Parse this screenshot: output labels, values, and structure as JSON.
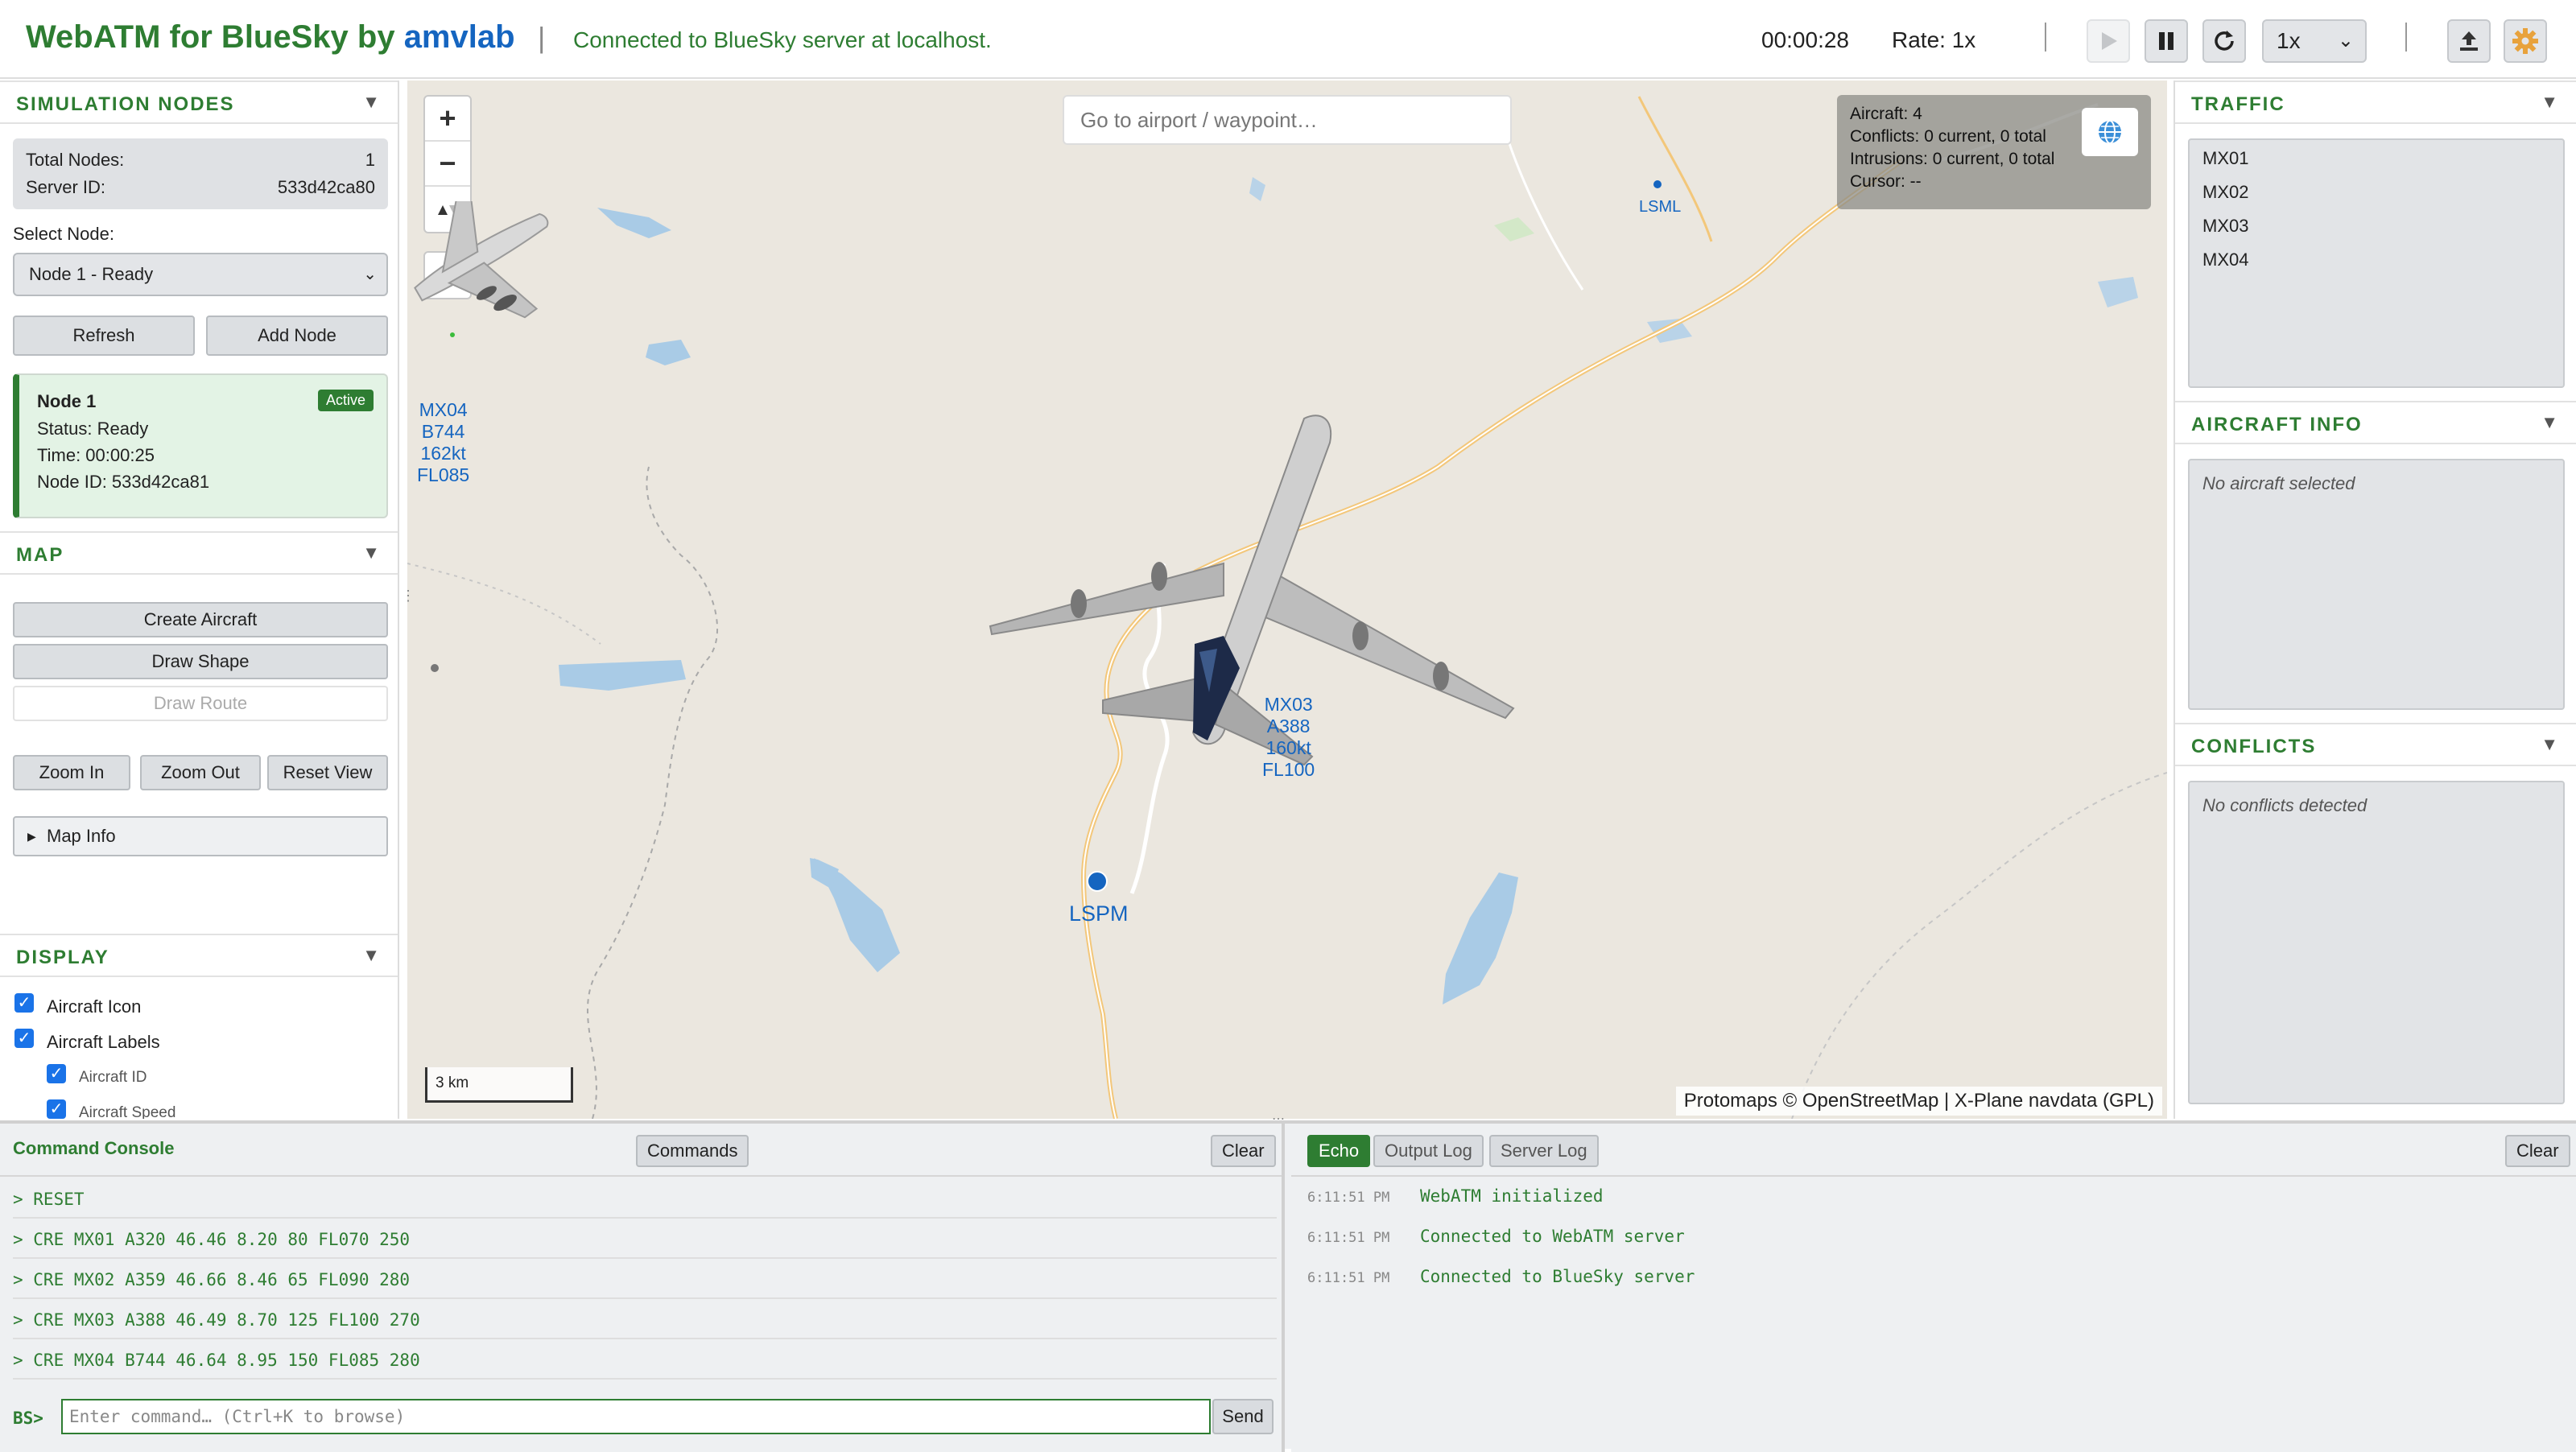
{
  "header": {
    "title_prefix": "WebATM for BlueSky by ",
    "title_brand": "amvlab",
    "separator": "|",
    "connection_status": "Connected to BlueSky server at localhost.",
    "sim_time": "00:00:28",
    "rate": "Rate: 1x",
    "speed_value": "1x",
    "colors": {
      "title": "#2e7d32",
      "brand": "#1565c0"
    }
  },
  "sim_nodes": {
    "title": "SIMULATION NODES",
    "total_nodes_label": "Total Nodes:",
    "total_nodes_value": "1",
    "server_id_label": "Server ID:",
    "server_id_value": "533d42ca80",
    "select_label": "Select Node:",
    "selected_node": "Node 1 - Ready",
    "refresh_label": "Refresh",
    "add_node_label": "Add Node",
    "card": {
      "name": "Node 1",
      "badge": "Active",
      "status": "Status: Ready",
      "time": "Time: 00:00:25",
      "node_id": "Node ID: 533d42ca81"
    }
  },
  "map_section": {
    "title": "MAP",
    "create_aircraft": "Create Aircraft",
    "draw_shape": "Draw Shape",
    "draw_route": "Draw Route",
    "zoom_in": "Zoom In",
    "zoom_out": "Zoom Out",
    "reset_view": "Reset View",
    "map_info": "Map Info"
  },
  "display_section": {
    "title": "DISPLAY",
    "aircraft_icon": "Aircraft Icon",
    "aircraft_labels": "Aircraft Labels",
    "aircraft_id": "Aircraft ID",
    "aircraft_speed": "Aircraft Speed"
  },
  "map": {
    "search_placeholder": "Go to airport / waypoint…",
    "stats": {
      "aircraft": "Aircraft: 4",
      "conflicts": "Conflicts: 0 current, 0 total",
      "intrusions": "Intrusions: 0 current, 0 total",
      "cursor": "Cursor: --"
    },
    "aircraft": [
      {
        "id": "MX04",
        "type": "B744",
        "speed": "162kt",
        "fl": "FL085"
      },
      {
        "id": "MX03",
        "type": "A388",
        "speed": "160kt",
        "fl": "FL100"
      }
    ],
    "waypoints": {
      "lsml": "LSML",
      "lspm": "LSPM"
    },
    "scale": "3 km",
    "attribution": "Protomaps © OpenStreetMap | X-Plane navdata (GPL)"
  },
  "traffic": {
    "title": "TRAFFIC",
    "items": [
      "MX01",
      "MX02",
      "MX03",
      "MX04"
    ]
  },
  "aircraft_info": {
    "title": "AIRCRAFT INFO",
    "empty": "No aircraft selected"
  },
  "conflicts": {
    "title": "CONFLICTS",
    "empty": "No conflicts detected"
  },
  "console": {
    "title": "Command Console",
    "commands_btn": "Commands",
    "clear_btn": "Clear",
    "lines": [
      "> RESET",
      "> CRE MX01 A320 46.46 8.20 80 FL070 250",
      "> CRE MX02 A359 46.66 8.46 65 FL090 280",
      "> CRE MX03 A388 46.49 8.70 125 FL100 270",
      "> CRE MX04 B744 46.64 8.95 150 FL085 280"
    ],
    "prompt": "BS>",
    "input_placeholder": "Enter command… (Ctrl+K to browse)",
    "send_btn": "Send"
  },
  "log": {
    "tabs": [
      "Echo",
      "Output Log",
      "Server Log"
    ],
    "clear_btn": "Clear",
    "entries": [
      {
        "time": "6:11:51 PM",
        "text": "WebATM initialized"
      },
      {
        "time": "6:11:51 PM",
        "text": "Connected to WebATM server"
      },
      {
        "time": "6:11:51 PM",
        "text": "Connected to BlueSky server"
      }
    ]
  }
}
